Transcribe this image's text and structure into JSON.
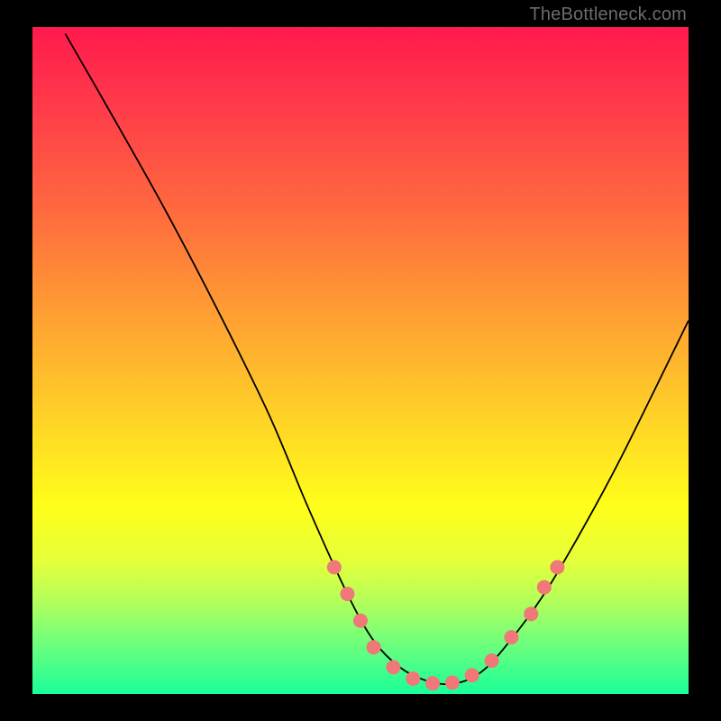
{
  "attribution": "TheBottleneck.com",
  "chart_data": {
    "type": "line",
    "title": "",
    "xlabel": "",
    "ylabel": "",
    "xlim": [
      0,
      100
    ],
    "ylim": [
      0,
      100
    ],
    "curve_points": [
      {
        "x": 5,
        "y": 99
      },
      {
        "x": 12,
        "y": 87
      },
      {
        "x": 20,
        "y": 73
      },
      {
        "x": 28,
        "y": 58
      },
      {
        "x": 36,
        "y": 42
      },
      {
        "x": 42,
        "y": 28
      },
      {
        "x": 48,
        "y": 15
      },
      {
        "x": 52,
        "y": 8
      },
      {
        "x": 56,
        "y": 4
      },
      {
        "x": 60,
        "y": 2
      },
      {
        "x": 64,
        "y": 1.5
      },
      {
        "x": 68,
        "y": 3
      },
      {
        "x": 72,
        "y": 7
      },
      {
        "x": 78,
        "y": 15
      },
      {
        "x": 84,
        "y": 25
      },
      {
        "x": 90,
        "y": 36
      },
      {
        "x": 100,
        "y": 56
      }
    ],
    "markers": [
      {
        "x": 46,
        "y": 19
      },
      {
        "x": 48,
        "y": 15
      },
      {
        "x": 50,
        "y": 11
      },
      {
        "x": 52,
        "y": 7
      },
      {
        "x": 55,
        "y": 4
      },
      {
        "x": 58,
        "y": 2.3
      },
      {
        "x": 61,
        "y": 1.6
      },
      {
        "x": 64,
        "y": 1.7
      },
      {
        "x": 67,
        "y": 2.8
      },
      {
        "x": 70,
        "y": 5
      },
      {
        "x": 73,
        "y": 8.5
      },
      {
        "x": 76,
        "y": 12
      },
      {
        "x": 78,
        "y": 16
      },
      {
        "x": 80,
        "y": 19
      }
    ],
    "marker_color": "#f07878",
    "curve_color": "#000000"
  }
}
